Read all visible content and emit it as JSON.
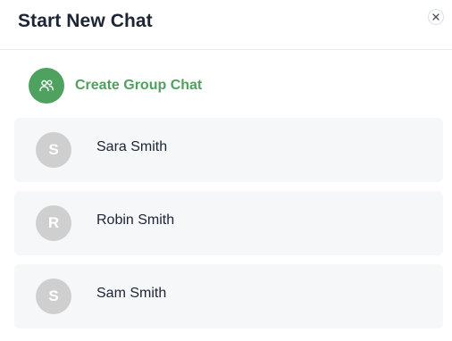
{
  "dialog": {
    "title": "Start New Chat",
    "close_icon": "close-icon"
  },
  "group_chat": {
    "label": "Create Group Chat",
    "icon": "group-users-icon",
    "accent_color": "#4fa15f"
  },
  "contacts": [
    {
      "initial": "S",
      "name": "Sara Smith"
    },
    {
      "initial": "R",
      "name": "Robin Smith"
    },
    {
      "initial": "S",
      "name": "Sam Smith"
    }
  ],
  "colors": {
    "avatar_bg": "#cfcfcf",
    "row_bg": "#f6f7f9",
    "title_text": "#1d2433"
  }
}
